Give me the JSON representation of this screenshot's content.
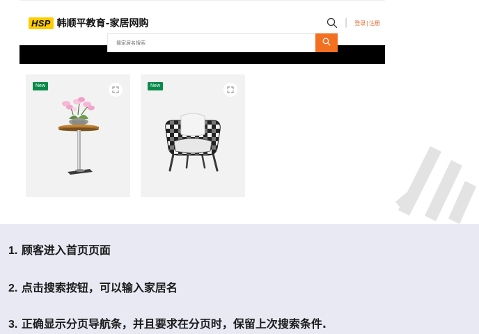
{
  "header": {
    "logo_badge": "HSP",
    "logo_title": "韩顺平教育-家居网购",
    "separator": "|",
    "login": "登录",
    "auth_sep": "|",
    "register": "注册",
    "search": {
      "placeholder": "搜家居名搜索"
    }
  },
  "products": [
    {
      "badge": "New",
      "image": "flower-side-table"
    },
    {
      "badge": "New",
      "image": "checkered-armchair"
    }
  ],
  "requirements": [
    {
      "num": "1.",
      "text": "顾客进入首页页面"
    },
    {
      "num": "2.",
      "text": "点击搜索按钮，可以输入家居名"
    },
    {
      "num": "3.",
      "text": "正确显示分页导航条，并且要求在分页时，保留上次搜索条件."
    }
  ],
  "colors": {
    "accent": "#f37021",
    "badge": "#0a8a4a",
    "logo": "#ffcc00",
    "panel": "#e8e9f3"
  }
}
